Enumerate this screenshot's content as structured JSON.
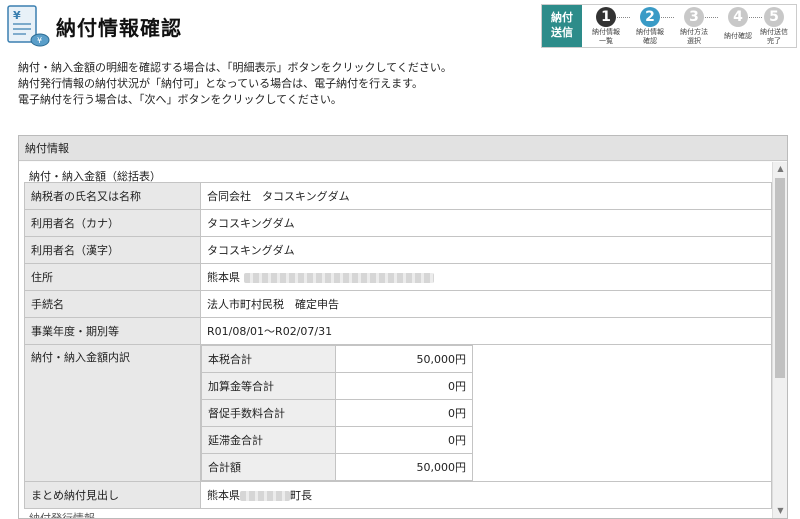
{
  "header": {
    "title": "納付情報確認",
    "send_label_1": "納付",
    "send_label_2": "送信",
    "logo_glyph": "¥",
    "steps": [
      {
        "num": "1",
        "label_1": "納付情報",
        "label_2": "一覧",
        "state": "done"
      },
      {
        "num": "2",
        "label_1": "納付情報",
        "label_2": "確認",
        "state": "active"
      },
      {
        "num": "3",
        "label_1": "納付方法",
        "label_2": "選択",
        "state": "pending"
      },
      {
        "num": "4",
        "label_1": "納付確認",
        "label_2": "",
        "state": "pending"
      },
      {
        "num": "5",
        "label_1": "納付送信",
        "label_2": "完了",
        "state": "pending"
      }
    ]
  },
  "instructions": [
    "納付・納入金額の明細を確認する場合は、「明細表示」ボタンをクリックしてください。",
    "納付発行情報の納付状況が「納付可」となっている場合は、電子納付を行えます。",
    "電子納付を行う場合は、「次へ」ボタンをクリックしてください。"
  ],
  "panel": {
    "heading": "納付情報",
    "section": "納付・納入金額（総括表）",
    "rows": {
      "taxpayer_key": "納税者の氏名又は名称",
      "taxpayer_val": "合同会社　タコスキングダム",
      "user_kana_key": "利用者名（カナ）",
      "user_kana_val": "タコスキングダム",
      "user_kanji_key": "利用者名（漢字）",
      "user_kanji_val": "タコスキングダム",
      "address_key": "住所",
      "address_val": "熊本県",
      "procedure_key": "手続名",
      "procedure_val": "法人市町村民税　確定申告",
      "period_key": "事業年度・期別等",
      "period_val": "R01/08/01～R02/07/31",
      "breakdown_key": "納付・納入金額内訳",
      "summary_key": "まとめ納付見出し",
      "summary_val_prefix": "熊本県",
      "summary_val_suffix": "町長"
    },
    "breakdown": [
      {
        "label": "本税合計",
        "value": "50,000円"
      },
      {
        "label": "加算金等合計",
        "value": "0円"
      },
      {
        "label": "督促手数料合計",
        "value": "0円"
      },
      {
        "label": "延滞金合計",
        "value": "0円"
      },
      {
        "label": "合計額",
        "value": "50,000円"
      }
    ],
    "next_section": "納付発行情報"
  }
}
